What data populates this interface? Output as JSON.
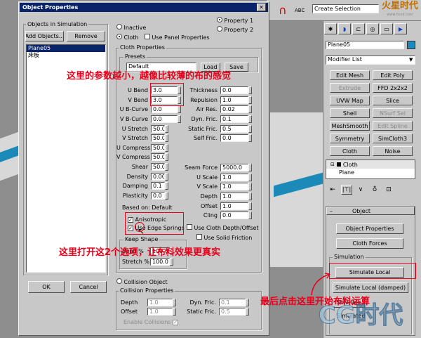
{
  "dialog": {
    "title": "Object Properties"
  },
  "left": {
    "objects_label": "Objects in Simulation",
    "add_objects": "Add Objects...",
    "remove": "Remove",
    "list": [
      "Plane05",
      "床板"
    ],
    "ok": "OK",
    "cancel": "Cancel"
  },
  "top_radios": {
    "inactive": "Inactive",
    "cloth": "Cloth",
    "use_panel": "Use Panel Properties",
    "property1": "Property 1",
    "property2": "Property 2"
  },
  "cloth_props": {
    "title": "Cloth Properties",
    "presets_title": "Presets",
    "preset_value": "Default",
    "load": "Load",
    "save": "Save"
  },
  "params_left": [
    {
      "label": "U Bend",
      "value": "3.0"
    },
    {
      "label": "V Bend",
      "value": "3.0"
    },
    {
      "label": "U B-Curve",
      "value": "0.0"
    },
    {
      "label": "V B-Curve",
      "value": "0.0"
    },
    {
      "label": "U Stretch",
      "value": "50.0"
    },
    {
      "label": "V Stretch",
      "value": "50.0"
    },
    {
      "label": "U Compress",
      "value": "50.0"
    },
    {
      "label": "V Compress",
      "value": "50.0"
    },
    {
      "label": "Shear",
      "value": "50.0"
    },
    {
      "label": "Density",
      "value": "0.005"
    },
    {
      "label": "Damping",
      "value": "0.1"
    },
    {
      "label": "Plasticity",
      "value": "0.0"
    }
  ],
  "params_right": [
    {
      "label": "Thickness",
      "value": "0.0"
    },
    {
      "label": "Repulsion",
      "value": "1.0"
    },
    {
      "label": "Air Res.",
      "value": "0.02"
    },
    {
      "label": "Dyn. Fric.",
      "value": "0.1"
    },
    {
      "label": "Static Fric.",
      "value": "0.5"
    },
    {
      "label": "Self Fric.",
      "value": "0.0"
    }
  ],
  "params_right2": [
    {
      "label": "Seam Force",
      "value": "5000.0"
    },
    {
      "label": "U Scale",
      "value": "1.0"
    },
    {
      "label": "V Scale",
      "value": "1.0"
    },
    {
      "label": "Depth",
      "value": "1.0"
    },
    {
      "label": "Offset",
      "value": "1.0"
    },
    {
      "label": "Cling",
      "value": "0.0"
    }
  ],
  "based_on": "Based on: Default",
  "checks": {
    "anisotropic": "Anisotropic",
    "use_edge": "Use Edge Springs",
    "use_depth": "Use Cloth Depth/Offset",
    "use_solid": "Use Solid Friction"
  },
  "keep_shape": {
    "title": "Keep Shape",
    "bend": "Bend %",
    "bend_val": "100.0",
    "stretch": "Stretch %",
    "stretch_val": "100.0"
  },
  "collision": {
    "radio": "Collision Object",
    "title": "Collision Properties",
    "depth": "Depth",
    "depth_val": "1.0",
    "offset": "Offset",
    "offset_val": "1.0",
    "dyn": "Dyn. Fric.",
    "dyn_val": "0.1",
    "stat": "Static Fric.",
    "stat_val": "0.5",
    "enable": "Enable Collisions"
  },
  "right_panel": {
    "object_name": "Plane05",
    "modifier_list": "Modifier List",
    "buttons": [
      [
        "Edit Mesh",
        "Edit Poly"
      ],
      [
        "Extrude",
        "FFD 2x2x2"
      ],
      [
        "UVW Map",
        "Slice"
      ],
      [
        "Shell",
        "NSurf Sel"
      ],
      [
        "MeshSmooth",
        "Edit Spline"
      ],
      [
        "Symmetry",
        "SimCloth3"
      ],
      [
        "Cloth",
        "Noise"
      ]
    ],
    "stack": [
      "Cloth",
      "Plane"
    ],
    "object_rollout": "Object",
    "object_properties": "Object Properties",
    "cloth_forces": "Cloth Forces",
    "simulation_label": "Simulation",
    "simulate_local": "Simulate Local",
    "simulate_local_damped": "Simulate Local (damped)",
    "simulate": "Simulate",
    "simulated_frame": "Simulated"
  },
  "toolbar": {
    "selection_set": "Create Selection"
  },
  "annotations": {
    "a1": "这里的参数越小，越像比较薄的布的感觉",
    "a2": "这里打开这2个选项，让布料效果更真实",
    "a3": "最后点击这里开始布料运算"
  },
  "watermark": {
    "brand": "火星时代",
    "url": "www.hxsd.com",
    "logo": "CG时代"
  },
  "colors": {
    "dialog_title": "#0a246a",
    "annotation": "#e8001b",
    "panel": "#c8c8c8"
  }
}
